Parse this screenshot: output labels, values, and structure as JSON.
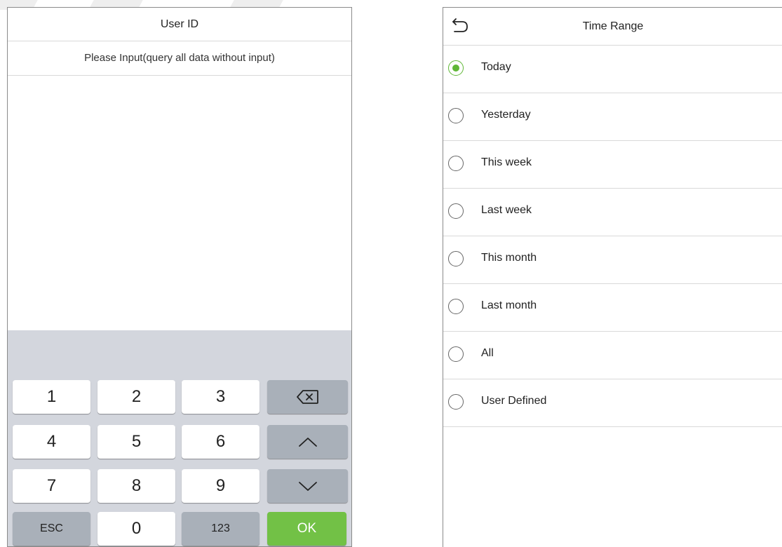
{
  "left_panel": {
    "title": "User ID",
    "input_placeholder": "Please Input(query all data without input)",
    "keys": {
      "k1": "1",
      "k2": "2",
      "k3": "3",
      "k4": "4",
      "k5": "5",
      "k6": "6",
      "k7": "7",
      "k8": "8",
      "k9": "9",
      "esc": "ESC",
      "k0": "0",
      "mode": "123",
      "ok": "OK"
    },
    "icons": {
      "backspace": "backspace-icon",
      "up": "chevron-up-icon",
      "down": "chevron-down-icon"
    },
    "colors": {
      "ok_key": "#72c146",
      "keypad_bg": "#d3d6dd",
      "function_key": "#a9b0b9"
    }
  },
  "right_panel": {
    "title": "Time Range",
    "back_icon": "back-arrow-icon",
    "selected_index": 0,
    "accent_color": "#5fb736",
    "options": [
      {
        "label": "Today",
        "selected": true
      },
      {
        "label": "Yesterday",
        "selected": false
      },
      {
        "label": "This week",
        "selected": false
      },
      {
        "label": "Last week",
        "selected": false
      },
      {
        "label": "This month",
        "selected": false
      },
      {
        "label": "Last month",
        "selected": false
      },
      {
        "label": "All",
        "selected": false
      },
      {
        "label": "User Defined",
        "selected": false
      }
    ]
  }
}
